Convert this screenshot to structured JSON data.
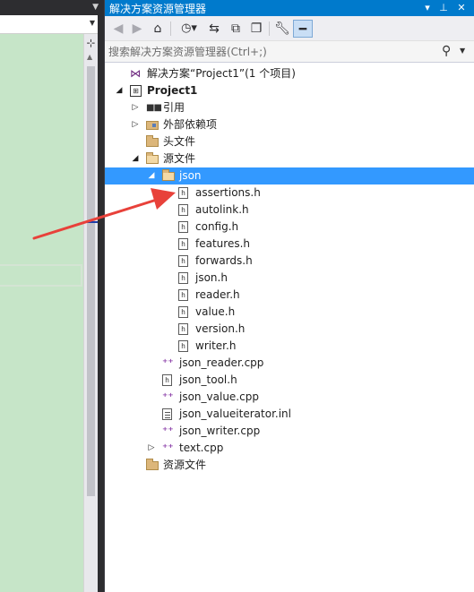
{
  "window_title": "解决方案资源管理器",
  "title_buttons": [
    "▾",
    "⊥",
    "✕"
  ],
  "toolbar": {
    "back_icon": "back-icon",
    "forward_icon": "forward-icon",
    "home_icon": "home-icon",
    "history_icon": "history-icon",
    "sync_icon": "sync-icon",
    "collapse_icon": "collapse-all-icon",
    "show_all_icon": "show-all-files-icon",
    "properties_icon": "wrench-icon",
    "preview_icon": "preview-icon"
  },
  "search": {
    "placeholder": "搜索解决方案资源管理器(Ctrl+;)"
  },
  "tree": [
    {
      "label": "解决方案“Project1”(1 个项目)",
      "icon": "solution",
      "depth": 0,
      "expander": "",
      "bold": false
    },
    {
      "label": "Project1",
      "icon": "project",
      "depth": 0,
      "expander": "expanded",
      "bold": true
    },
    {
      "label": "引用",
      "icon": "references",
      "depth": 1,
      "expander": "collapsed",
      "bold": false
    },
    {
      "label": "外部依赖项",
      "icon": "external",
      "depth": 1,
      "expander": "collapsed",
      "bold": false
    },
    {
      "label": "头文件",
      "icon": "folder",
      "depth": 1,
      "expander": "",
      "bold": false
    },
    {
      "label": "源文件",
      "icon": "folder-open",
      "depth": 1,
      "expander": "expanded",
      "bold": false
    },
    {
      "label": "json",
      "icon": "folder-open",
      "depth": 2,
      "expander": "expanded",
      "bold": false,
      "selected": true
    },
    {
      "label": "assertions.h",
      "icon": "header",
      "depth": 3,
      "expander": "",
      "bold": false
    },
    {
      "label": "autolink.h",
      "icon": "header",
      "depth": 3,
      "expander": "",
      "bold": false
    },
    {
      "label": "config.h",
      "icon": "header",
      "depth": 3,
      "expander": "",
      "bold": false
    },
    {
      "label": "features.h",
      "icon": "header",
      "depth": 3,
      "expander": "",
      "bold": false
    },
    {
      "label": "forwards.h",
      "icon": "header",
      "depth": 3,
      "expander": "",
      "bold": false
    },
    {
      "label": "json.h",
      "icon": "header",
      "depth": 3,
      "expander": "",
      "bold": false
    },
    {
      "label": "reader.h",
      "icon": "header",
      "depth": 3,
      "expander": "",
      "bold": false
    },
    {
      "label": "value.h",
      "icon": "header",
      "depth": 3,
      "expander": "",
      "bold": false
    },
    {
      "label": "version.h",
      "icon": "header",
      "depth": 3,
      "expander": "",
      "bold": false
    },
    {
      "label": "writer.h",
      "icon": "header",
      "depth": 3,
      "expander": "",
      "bold": false
    },
    {
      "label": "json_reader.cpp",
      "icon": "cpp",
      "depth": 2,
      "expander": "",
      "bold": false
    },
    {
      "label": "json_tool.h",
      "icon": "header",
      "depth": 2,
      "expander": "",
      "bold": false
    },
    {
      "label": "json_value.cpp",
      "icon": "cpp",
      "depth": 2,
      "expander": "",
      "bold": false
    },
    {
      "label": "json_valueiterator.inl",
      "icon": "inline",
      "depth": 2,
      "expander": "",
      "bold": false
    },
    {
      "label": "json_writer.cpp",
      "icon": "cpp",
      "depth": 2,
      "expander": "",
      "bold": false
    },
    {
      "label": "text.cpp",
      "icon": "cpp",
      "depth": 2,
      "expander": "collapsed",
      "bold": false
    },
    {
      "label": "资源文件",
      "icon": "folder",
      "depth": 1,
      "expander": "",
      "bold": false
    }
  ],
  "colors": {
    "title_bar": "#007acc",
    "selection": "#3399ff",
    "editor_bg": "#c6e5c8",
    "annotation_arrow": "#e8413a"
  }
}
